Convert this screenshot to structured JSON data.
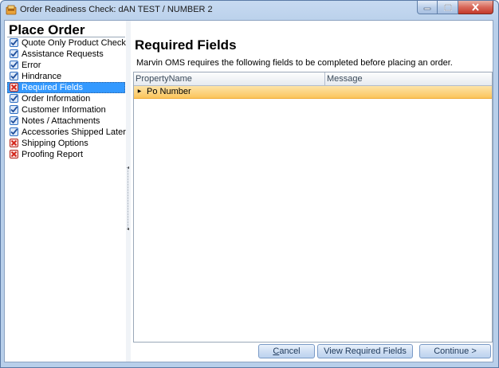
{
  "window": {
    "title": "Order Readiness Check: dAN TEST / NUMBER 2"
  },
  "left": {
    "heading": "Place Order",
    "items": [
      {
        "label": "Quote Only Product Check",
        "status": "ok"
      },
      {
        "label": "Assistance Requests",
        "status": "ok"
      },
      {
        "label": "Error",
        "status": "ok"
      },
      {
        "label": "Hindrance",
        "status": "ok"
      },
      {
        "label": "Required Fields",
        "status": "fail",
        "selected": true
      },
      {
        "label": "Order Information",
        "status": "ok"
      },
      {
        "label": "Customer Information",
        "status": "ok"
      },
      {
        "label": "Notes / Attachments",
        "status": "ok"
      },
      {
        "label": "Accessories Shipped Later",
        "status": "ok"
      },
      {
        "label": "Shipping Options",
        "status": "fail"
      },
      {
        "label": "Proofing Report",
        "status": "fail"
      }
    ]
  },
  "main": {
    "title": "Required Fields",
    "description": "Marvin OMS requires the following fields to be completed before placing an order.",
    "grid": {
      "columns": [
        "PropertyName",
        "Message"
      ],
      "rows": [
        {
          "property": "Po Number",
          "message": ""
        }
      ]
    }
  },
  "buttons": {
    "cancel_first": "C",
    "cancel_rest": "ancel",
    "view_required": "View Required Fields",
    "continue": "Continue >"
  },
  "colors": {
    "selection": "#3399ff",
    "row_highlight": "#fbc55c",
    "ok_icon": "#2f6fc4",
    "fail_icon": "#d4281c"
  }
}
